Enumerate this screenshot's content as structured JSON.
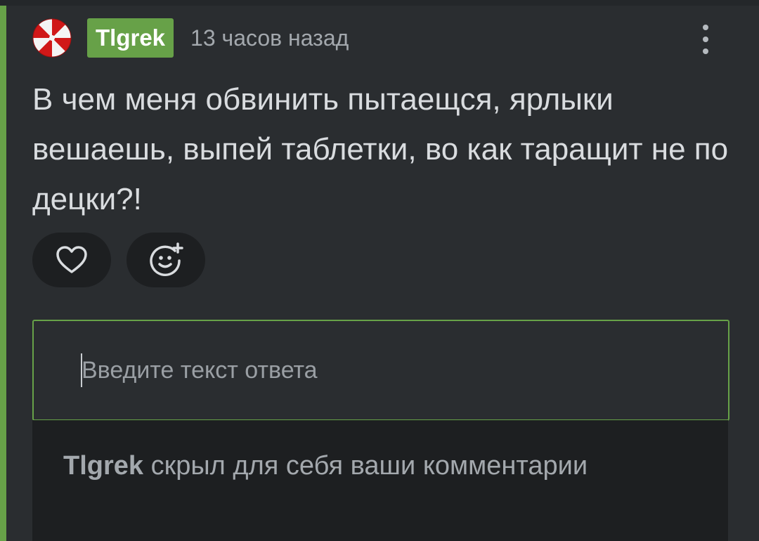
{
  "comment": {
    "author": "Tlgrek",
    "time": "13 часов назад",
    "text": "В чем меня обвинить пытаещся, ярлыки вешаешь, выпей таблетки, во как таращит не по децки?!",
    "avatar_icon": "umbrella-corp-logo-icon",
    "menu_icon": "more-vertical-icon"
  },
  "actions": {
    "like_icon": "heart-icon",
    "react_icon": "add-reaction-icon"
  },
  "reply": {
    "placeholder": "Введите текст ответа",
    "value": ""
  },
  "notice": {
    "user": "Tlgrek",
    "message": " скрыл для себя ваши комментарии"
  },
  "colors": {
    "accent": "#67a148",
    "background": "#2a2d30",
    "button_bg": "#1d1f21",
    "text": "#d9dcdf",
    "muted": "#a3a8ad"
  }
}
